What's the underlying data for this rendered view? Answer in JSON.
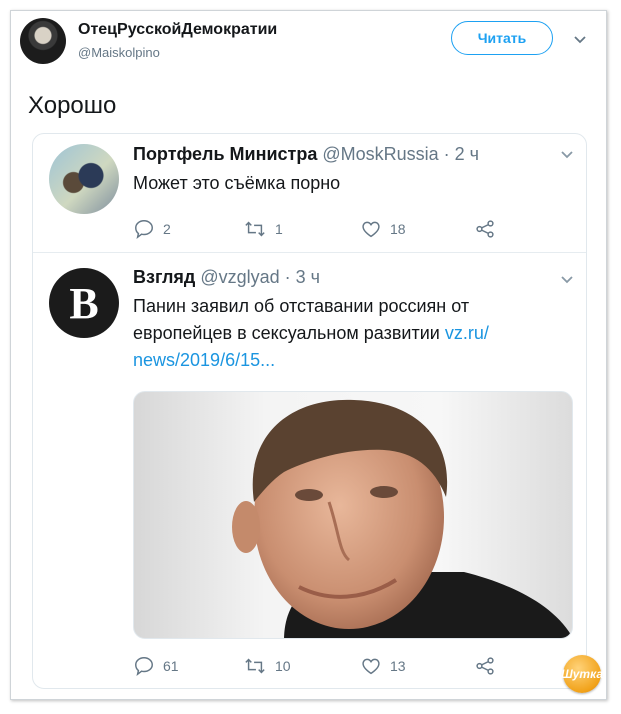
{
  "author": {
    "display_name": "ОтецРусскойДемократии",
    "handle": "@Maiskolpino",
    "follow_label": "Читать"
  },
  "tweet": {
    "text": "Хорошо"
  },
  "thread": [
    {
      "name": "Портфель Министра",
      "meta": "@MoskRussia · 2 ч",
      "text": "Может это съёмка порно",
      "replies": "2",
      "retweets": "1",
      "likes": "18"
    },
    {
      "name": "Взгляд",
      "meta": "@vzglyad · 3 ч",
      "text": "Панин заявил об отставании россиян от европейцев в сексуальном развитии",
      "link": "vz.ru/ news/2019/6/15...",
      "replies": "61",
      "retweets": "10",
      "likes": "13"
    }
  ],
  "watermark": "Шутка"
}
